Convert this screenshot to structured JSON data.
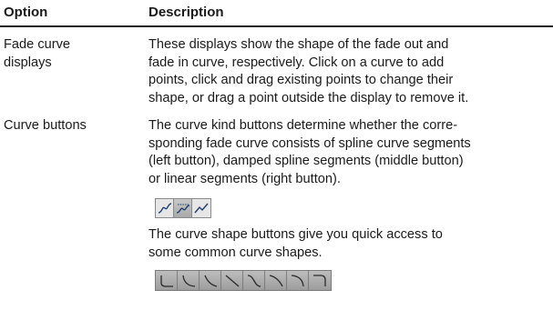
{
  "table": {
    "header": {
      "option": "Option",
      "description": "Description"
    },
    "rows": [
      {
        "option_lines": [
          "Fade curve",
          "displays"
        ],
        "description_lines": [
          "These displays show the shape of the fade out and",
          "fade in curve, respectively. Click on a curve to add",
          "points, click and drag existing points to change their",
          "shape, or drag a point outside the display to remove it."
        ]
      },
      {
        "option_lines": [
          "Curve buttons"
        ],
        "description_lines": [
          "The curve kind buttons determine whether the corre-",
          "sponding fade curve consists of spline curve segments",
          "(left button), damped spline segments (middle button)",
          "or linear segments (right button)."
        ],
        "description2_lines": [
          "The curve shape buttons give you quick access to",
          "some common curve shapes."
        ]
      }
    ]
  },
  "curve_kind_buttons": [
    {
      "icon": "spline-curve-icon"
    },
    {
      "icon": "damped-spline-icon"
    },
    {
      "icon": "linear-curve-icon"
    }
  ],
  "curve_shape_buttons": [
    {
      "icon": "curve-shape-1-icon"
    },
    {
      "icon": "curve-shape-2-icon"
    },
    {
      "icon": "curve-shape-3-icon"
    },
    {
      "icon": "curve-shape-4-icon"
    },
    {
      "icon": "curve-shape-5-icon"
    },
    {
      "icon": "curve-shape-6-icon"
    },
    {
      "icon": "curve-shape-7-icon"
    },
    {
      "icon": "curve-shape-8-icon"
    }
  ],
  "colors": {
    "text": "#1a1a1a",
    "button_face": "#b9b9b9",
    "button_border": "#8a8a8a"
  }
}
